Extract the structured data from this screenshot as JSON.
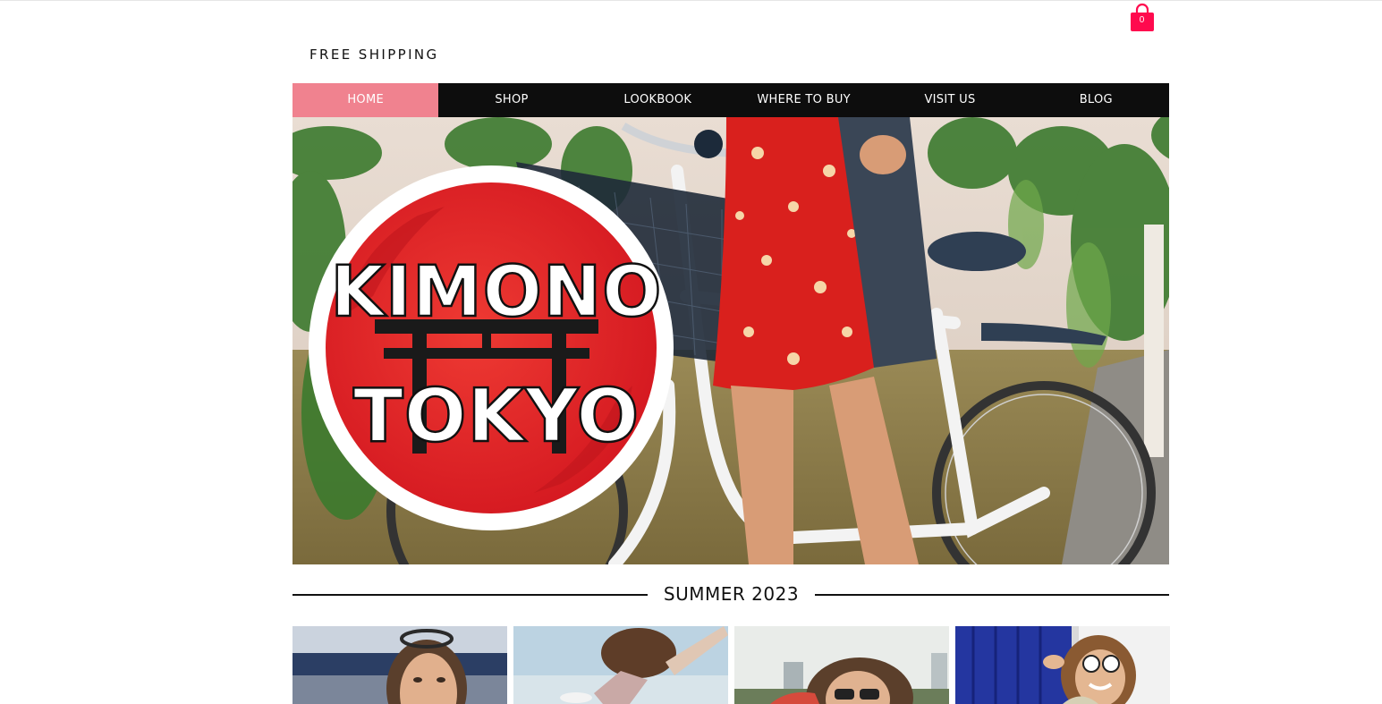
{
  "header": {
    "promo_text": "FREE SHIPPING",
    "cart": {
      "count": "0",
      "icon": "shopping-bag-icon",
      "color": "#ff0a4e"
    }
  },
  "nav": {
    "active_color": "#f0828f",
    "background": "#0d0d0d",
    "items": [
      {
        "label": "HOME",
        "active": true
      },
      {
        "label": "SHOP",
        "active": false
      },
      {
        "label": "LOOKBOOK",
        "active": false
      },
      {
        "label": "WHERE TO BUY",
        "active": false
      },
      {
        "label": "VISIT US",
        "active": false
      },
      {
        "label": "BLOG",
        "active": false
      }
    ]
  },
  "hero": {
    "logo": {
      "line1": "KIMONO",
      "line2": "TOKYO",
      "accent": "#e8212c"
    }
  },
  "section": {
    "title": "SUMMER 2023"
  },
  "thumbnails": [
    {
      "subject": "woman with sunglasses on head"
    },
    {
      "subject": "woman jumping with curly hair"
    },
    {
      "subject": "woman with sunglasses in city"
    },
    {
      "subject": "woman with white sunglasses by blue door"
    }
  ]
}
